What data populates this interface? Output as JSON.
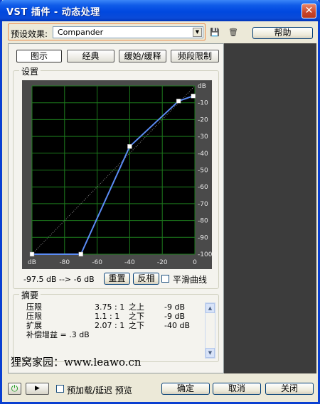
{
  "window": {
    "title": "VST 插件 - 动态处理",
    "close_glyph": "✕"
  },
  "preset": {
    "label": "预设效果:",
    "value": "Compander",
    "help_label": "帮助",
    "save_icon": "disk-icon",
    "delete_icon": "trash-icon"
  },
  "tabs": [
    {
      "label": "图示",
      "active": true
    },
    {
      "label": "经典",
      "active": false
    },
    {
      "label": "缓始/缓释",
      "active": false
    },
    {
      "label": "频段限制",
      "active": false
    }
  ],
  "settings": {
    "group_label": "设置",
    "readout": "-97.5 dB --> -6 dB",
    "reset_label": "重置",
    "invert_label": "反相",
    "smooth_label": "平滑曲线",
    "smooth_checked": false
  },
  "chart_data": {
    "type": "line",
    "title": "",
    "xlabel": "dB",
    "ylabel": "dB",
    "xlim": [
      -100,
      0
    ],
    "ylim": [
      -100,
      0
    ],
    "x_ticks": [
      "dB",
      "-80",
      "-60",
      "-40",
      "-20",
      "0"
    ],
    "x_tick_values": [
      -100,
      -80,
      -60,
      -40,
      -20,
      0
    ],
    "y_ticks": [
      "dB",
      "-10",
      "-20",
      "-30",
      "-40",
      "-50",
      "-60",
      "-70",
      "-80",
      "-90",
      "-100"
    ],
    "y_tick_values": [
      0,
      -10,
      -20,
      -30,
      -40,
      -50,
      -60,
      -70,
      -80,
      -90,
      -100
    ],
    "grid": true,
    "colors": {
      "background": "#000000",
      "grid": "#1c7a1c",
      "curve": "#5b8cf5",
      "diagonal": "#8a8a8a",
      "point": "#ffffff"
    },
    "series": [
      {
        "x": [
          -100,
          -70,
          -40,
          -10,
          -1
        ],
        "y": [
          -100,
          -100,
          -36,
          -9,
          -6
        ]
      }
    ]
  },
  "summary": {
    "group_label": "摘要",
    "rows": [
      {
        "name": "压限",
        "ratio": "3.75 : 1",
        "rel": "之上",
        "db": "-9 dB"
      },
      {
        "name": "压限",
        "ratio": "1.1 : 1",
        "rel": "之下",
        "db": "-9 dB"
      },
      {
        "name": "扩展",
        "ratio": "2.07 : 1",
        "rel": "之下",
        "db": "-40 dB"
      }
    ],
    "gain": "补偿增益 = .3 dB"
  },
  "watermark": "狸窝家园：www.leawo.cn",
  "bottom": {
    "preroll_label": "预加载/延迟 预览",
    "ok_label": "确定",
    "cancel_label": "取消",
    "close_label": "关闭",
    "power_glyph": "⏻",
    "play_glyph": "▶"
  }
}
